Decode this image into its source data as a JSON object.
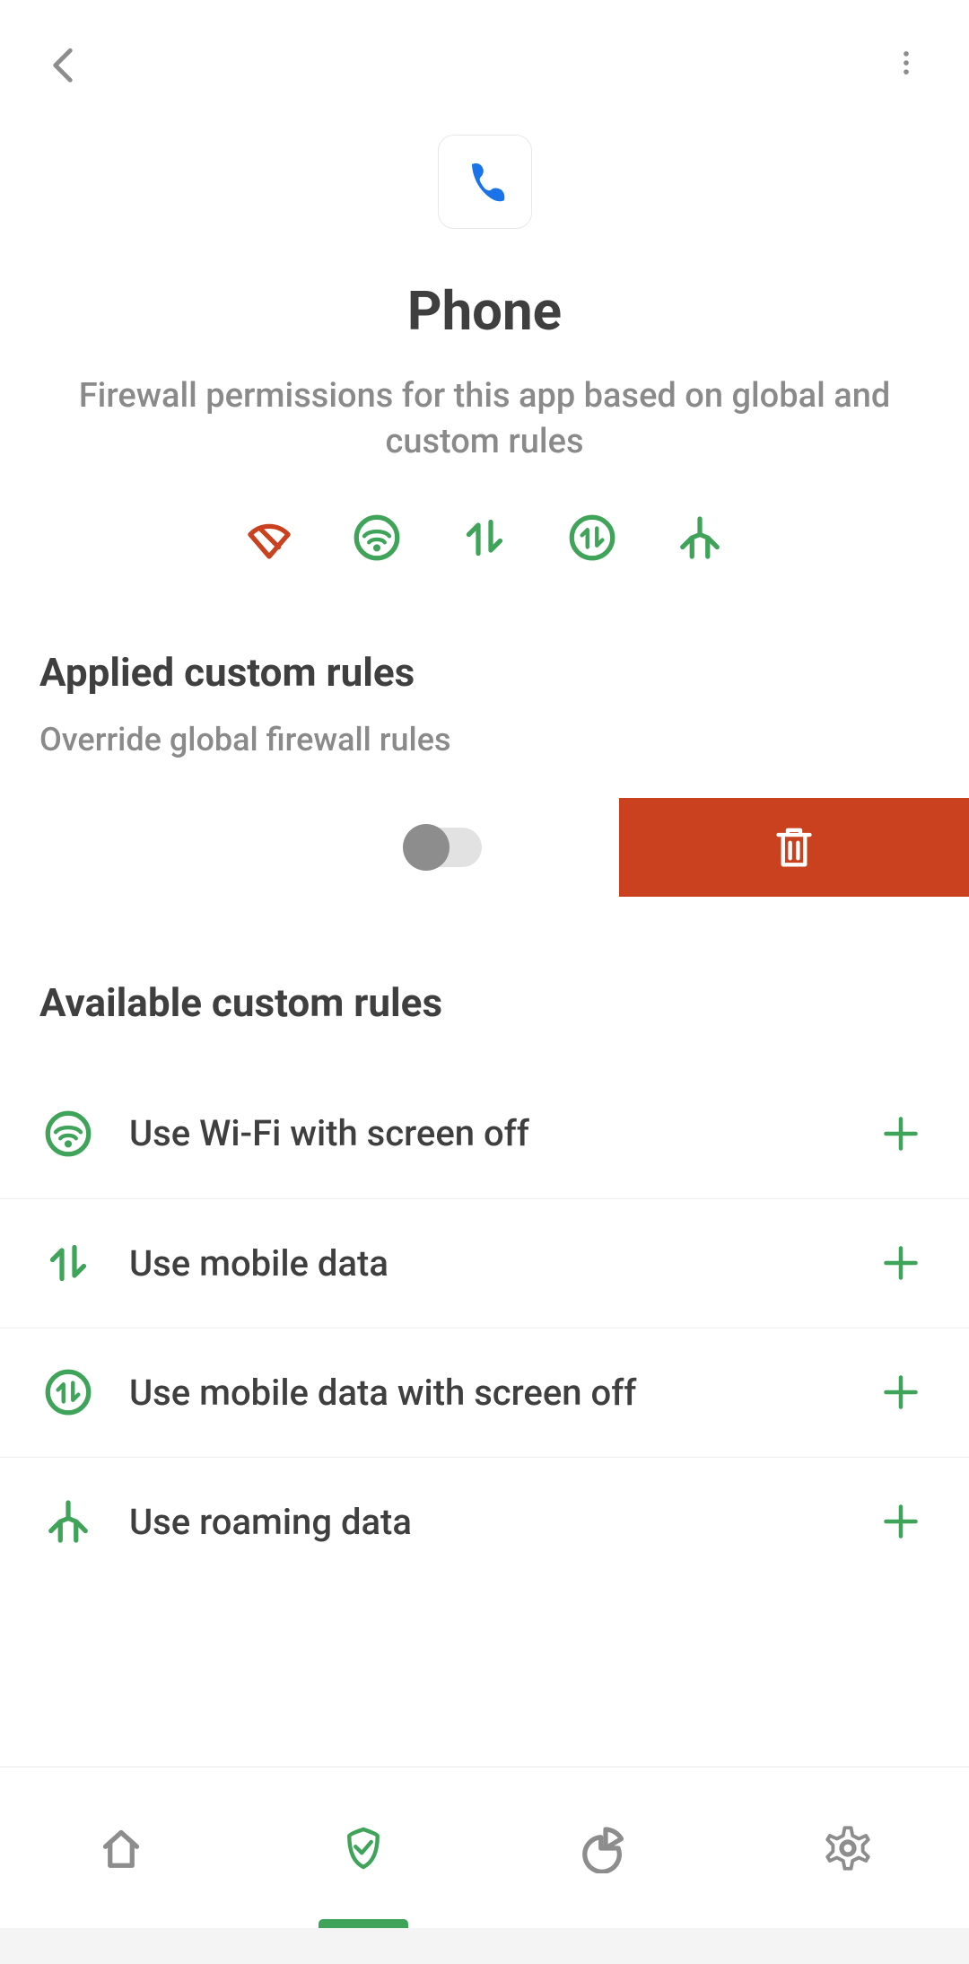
{
  "app": {
    "title": "Phone",
    "subtitle": "Firewall permissions for this app based on global and custom rules"
  },
  "status_icons": [
    {
      "name": "wifi-blocked",
      "color": "red"
    },
    {
      "name": "wifi-screen-off",
      "color": "green"
    },
    {
      "name": "mobile-data",
      "color": "green"
    },
    {
      "name": "mobile-data-screen-off",
      "color": "green"
    },
    {
      "name": "roaming",
      "color": "green"
    }
  ],
  "applied": {
    "title": "Applied custom rules",
    "subtitle": "Override global firewall rules",
    "toggle": false
  },
  "available": {
    "title": "Available custom rules",
    "items": [
      {
        "icon": "wifi-screen-off",
        "label": "Use Wi-Fi with screen off"
      },
      {
        "icon": "mobile-data",
        "label": "Use mobile data"
      },
      {
        "icon": "mobile-data-screen-off",
        "label": "Use mobile data with screen off"
      },
      {
        "icon": "roaming",
        "label": "Use roaming data"
      }
    ]
  },
  "nav": {
    "active_index": 1
  },
  "colors": {
    "green": "#3fa35a",
    "red": "#c9411f",
    "gray": "#8d8d8d"
  }
}
